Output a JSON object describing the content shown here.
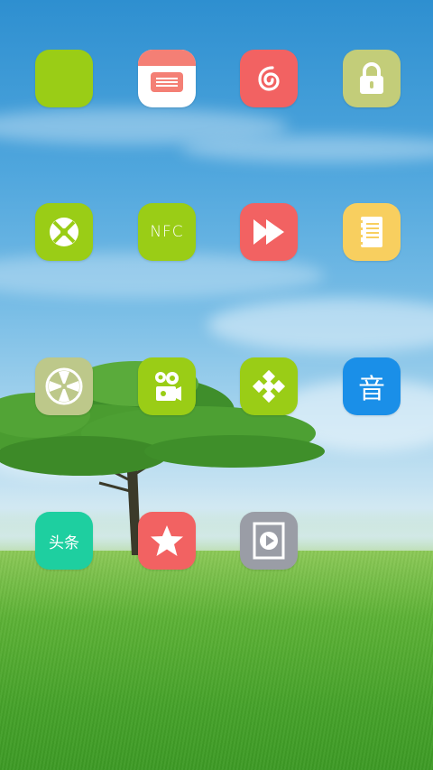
{
  "colors": {
    "green": "#9acd16",
    "coral": "#f26262",
    "olive_green": "#c3cd79",
    "sage": "#bdc88a",
    "yellow": "#f8cf5f",
    "blue": "#1a8fe8",
    "teal": "#1ecfa0",
    "gray": "#9a9da6",
    "white": "#ffffff"
  },
  "apps": [
    {
      "icon": "blank-green-app-icon"
    },
    {
      "icon": "message-card-icon"
    },
    {
      "icon": "netease-music-icon"
    },
    {
      "icon": "lock-icon"
    },
    {
      "icon": "aperture-icon"
    },
    {
      "icon": "nfc-icon",
      "label": "NFC"
    },
    {
      "icon": "fast-forward-icon"
    },
    {
      "icon": "notebook-icon"
    },
    {
      "icon": "fan-icon"
    },
    {
      "icon": "video-camera-icon"
    },
    {
      "icon": "diamond-dots-icon"
    },
    {
      "icon": "music-yin-icon",
      "label": "音"
    },
    {
      "icon": "toutiao-icon",
      "label": "头条"
    },
    {
      "icon": "star-icon"
    },
    {
      "icon": "video-player-icon"
    }
  ]
}
